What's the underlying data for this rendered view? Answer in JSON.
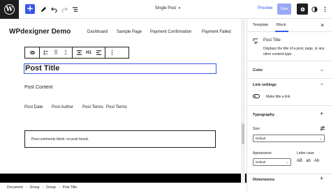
{
  "topbar": {
    "doc_title": "Single Post",
    "preview_label": "Preview",
    "save_label": "Save",
    "icons": [
      "wordpress-logo-icon",
      "plus-icon",
      "pencil-icon",
      "undo-icon",
      "redo-icon",
      "list-view-icon",
      "chevron-down-icon",
      "gear-icon",
      "contrast-icon",
      "more-vertical-icon"
    ]
  },
  "site": {
    "title": "WPdexigner Demo",
    "nav": [
      "Dashboard",
      "Sample Page",
      "Payment Confirmation",
      "Payment Failed"
    ]
  },
  "block_toolbar": {
    "heading_level": "H1"
  },
  "content": {
    "post_title": "Post Title",
    "post_content": "Post Content",
    "meta": [
      "Post Date",
      "Post Author",
      "Post Terms",
      "Post Terms"
    ],
    "meta_separator": "·",
    "comments_notice": "Post comments block: no post found."
  },
  "breadcrumb": [
    "Document",
    "Group",
    "Group",
    "Post Title"
  ],
  "breadcrumb_separator": "›",
  "sidebar": {
    "tabs": [
      "Template",
      "Block"
    ],
    "active_tab": "Block",
    "close_label": "×",
    "block_card": {
      "title": "Post Title",
      "description": "Displays the title of a post, page, or any other content-type."
    },
    "panels": {
      "color": "Color",
      "link_settings": "Link settings",
      "make_link_label": "Make title a link",
      "typography": "Typography",
      "size_label": "Size",
      "size_value": "Default",
      "appearance_label": "Appearance",
      "appearance_value": "Default",
      "letter_case_label": "Letter case",
      "letter_case_options": [
        "AB",
        "ab",
        "Ab"
      ],
      "dimensions": "Dimensions"
    }
  },
  "colors": {
    "accent": "#3858e9",
    "dark": "#1e1e1e",
    "save_disabled": "#9aa7f5"
  }
}
